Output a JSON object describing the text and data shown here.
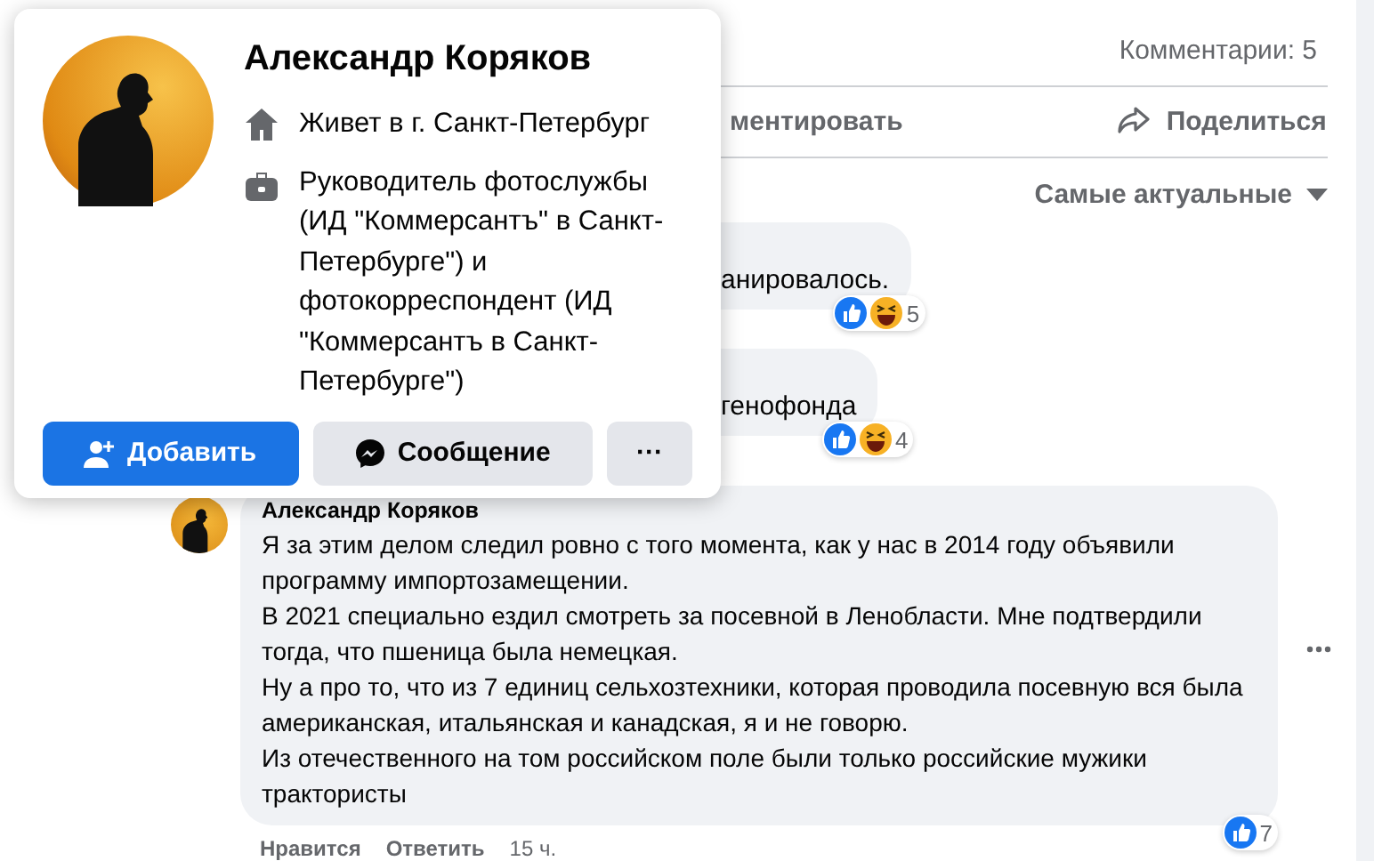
{
  "post": {
    "comments_count": "Комментарии: 5",
    "actions": [
      {
        "kind": "comment",
        "label": "ментировать"
      },
      {
        "kind": "share",
        "label": "Поделиться"
      }
    ],
    "sort": "Самые актуальные"
  },
  "hidden_comments": [
    {
      "text": "анировалось.",
      "reactions": "5"
    },
    {
      "text": "генофонда",
      "reactions": "4"
    }
  ],
  "comment": {
    "author": "Александр Коряков",
    "paragraphs": [
      "Я за этим делом следил ровно с того момента, как у нас в 2014 году объявили программу импортозамещении.",
      "В 2021 специально ездил смотреть за посевной в Ленобласти. Мне подтвердили тогда, что пшеница была немецкая.",
      "Ну а про то, что из 7 единиц сельхозтехники, которая проводила посевную вся была американская, итальянская и канадская, я и не говорю.",
      "Из отечественного на том российском поле были только российские мужики трактористы"
    ],
    "reactions": "7",
    "like": "Нравится",
    "reply": "Ответить",
    "time": "15 ч."
  },
  "profile_card": {
    "name": "Александр Коряков",
    "details": [
      {
        "kind": "home",
        "text": "Живет в г. Санкт-Петербург"
      },
      {
        "kind": "work",
        "text": "Руководитель фотослужбы (ИД \"Коммерсантъ\" в Санкт-Петербурге\") и фотокорреспондент (ИД \"Коммерсантъ в Санкт-Петербурге\")"
      }
    ],
    "buttons": [
      {
        "kind": "add",
        "label": "Добавить"
      },
      {
        "kind": "message",
        "label": "Сообщение"
      },
      {
        "kind": "more",
        "label": "···"
      }
    ]
  }
}
